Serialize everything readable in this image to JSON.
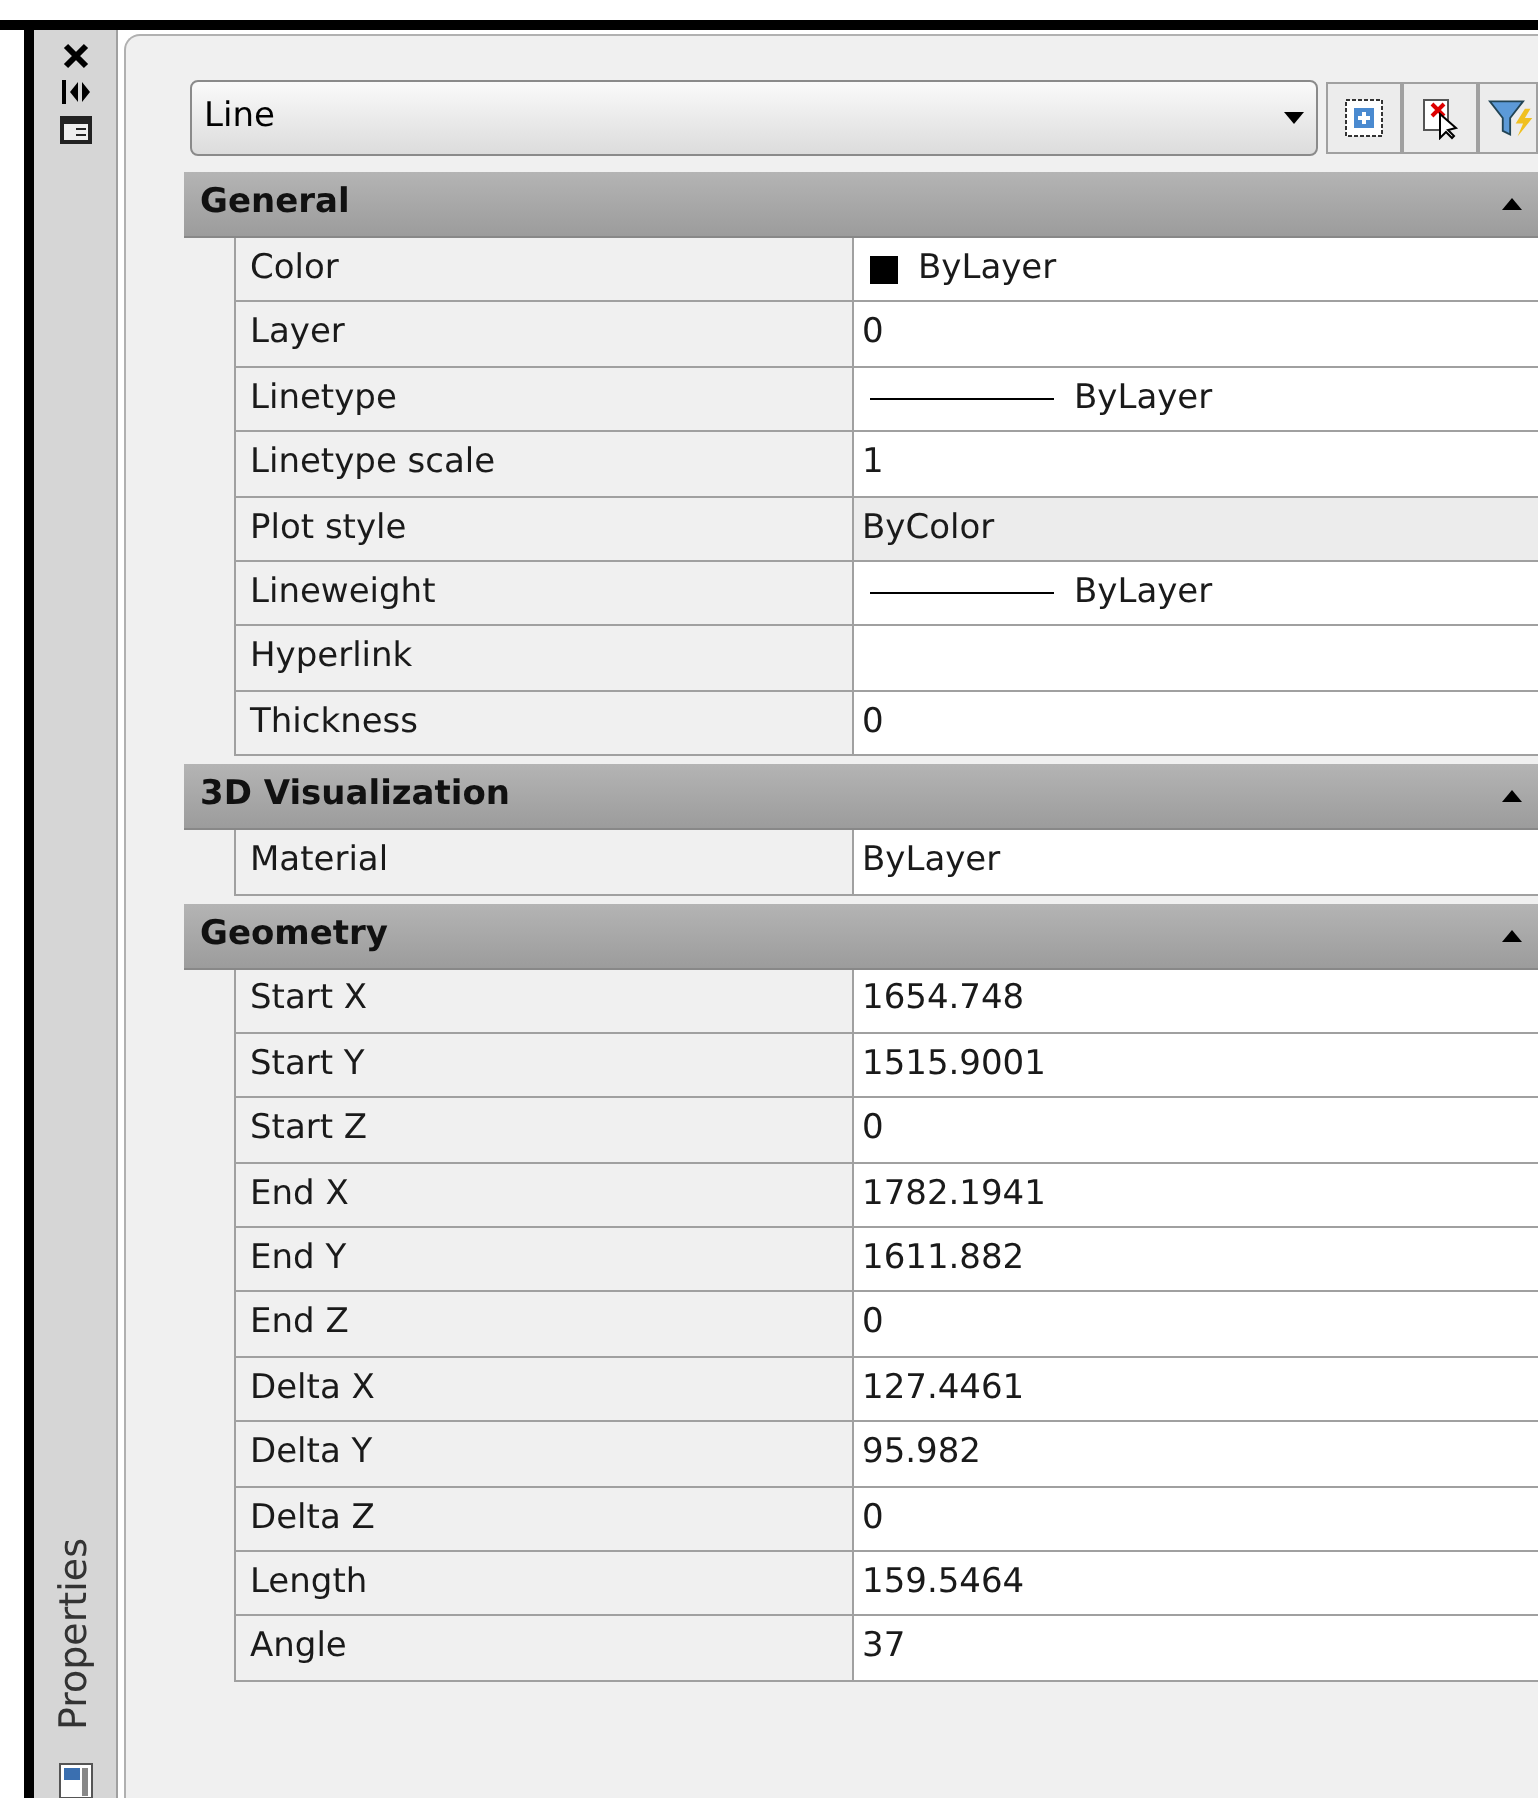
{
  "palette_title": "Properties",
  "selector": {
    "value": "Line"
  },
  "sections": [
    {
      "title": "General",
      "expanded": true,
      "rows": [
        {
          "label": "Color",
          "value": "ByLayer",
          "kind": "swatch",
          "disabled": false
        },
        {
          "label": "Layer",
          "value": "0",
          "kind": "text",
          "disabled": false
        },
        {
          "label": "Linetype",
          "value": "ByLayer",
          "kind": "line",
          "disabled": false
        },
        {
          "label": "Linetype scale",
          "value": "1",
          "kind": "text",
          "disabled": false
        },
        {
          "label": "Plot style",
          "value": "ByColor",
          "kind": "text",
          "disabled": true
        },
        {
          "label": "Lineweight",
          "value": "ByLayer",
          "kind": "line",
          "disabled": false
        },
        {
          "label": "Hyperlink",
          "kind": "text",
          "disabled": false
        },
        {
          "label": "Thickness",
          "value": "0",
          "kind": "text",
          "disabled": false
        }
      ]
    },
    {
      "title": "3D Visualization",
      "expanded": true,
      "rows": [
        {
          "label": "Material",
          "value": "ByLayer",
          "kind": "text",
          "disabled": false
        }
      ]
    },
    {
      "title": "Geometry",
      "expanded": true,
      "rows": [
        {
          "label": "Start X",
          "value": "1654.748",
          "kind": "text",
          "disabled": false
        },
        {
          "label": "Start Y",
          "value": "1515.9001",
          "kind": "text",
          "disabled": false
        },
        {
          "label": "Start Z",
          "value": "0",
          "kind": "text",
          "disabled": false
        },
        {
          "label": "End X",
          "value": "1782.1941",
          "kind": "text",
          "disabled": false
        },
        {
          "label": "End Y",
          "value": "1611.882",
          "kind": "text",
          "disabled": false
        },
        {
          "label": "End Z",
          "value": "0",
          "kind": "text",
          "disabled": false
        },
        {
          "label": "Delta X",
          "value": "127.4461",
          "kind": "text",
          "disabled": false
        },
        {
          "label": "Delta Y",
          "value": "95.982",
          "kind": "text",
          "disabled": false
        },
        {
          "label": "Delta Z",
          "value": "0",
          "kind": "text",
          "disabled": false
        },
        {
          "label": "Length",
          "value": "159.5464",
          "kind": "text",
          "disabled": false
        },
        {
          "label": "Angle",
          "value": "37",
          "kind": "text",
          "disabled": false
        }
      ]
    }
  ]
}
